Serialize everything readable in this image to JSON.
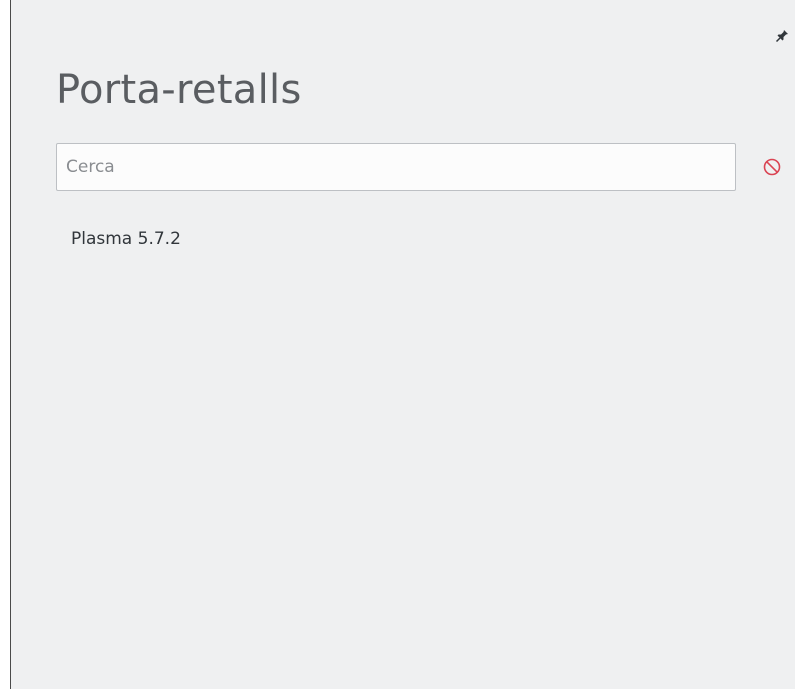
{
  "applet": {
    "title": "Porta-retalls",
    "pin_icon": "pin-icon",
    "clear_icon": "clear-history-icon"
  },
  "search": {
    "placeholder": "Cerca",
    "value": ""
  },
  "clips": [
    {
      "text": "Plasma 5.7.2"
    }
  ],
  "colors": {
    "panel_background": "#eff0f1",
    "clear_icon": "#da4453",
    "title_text": "#5a5d61"
  }
}
